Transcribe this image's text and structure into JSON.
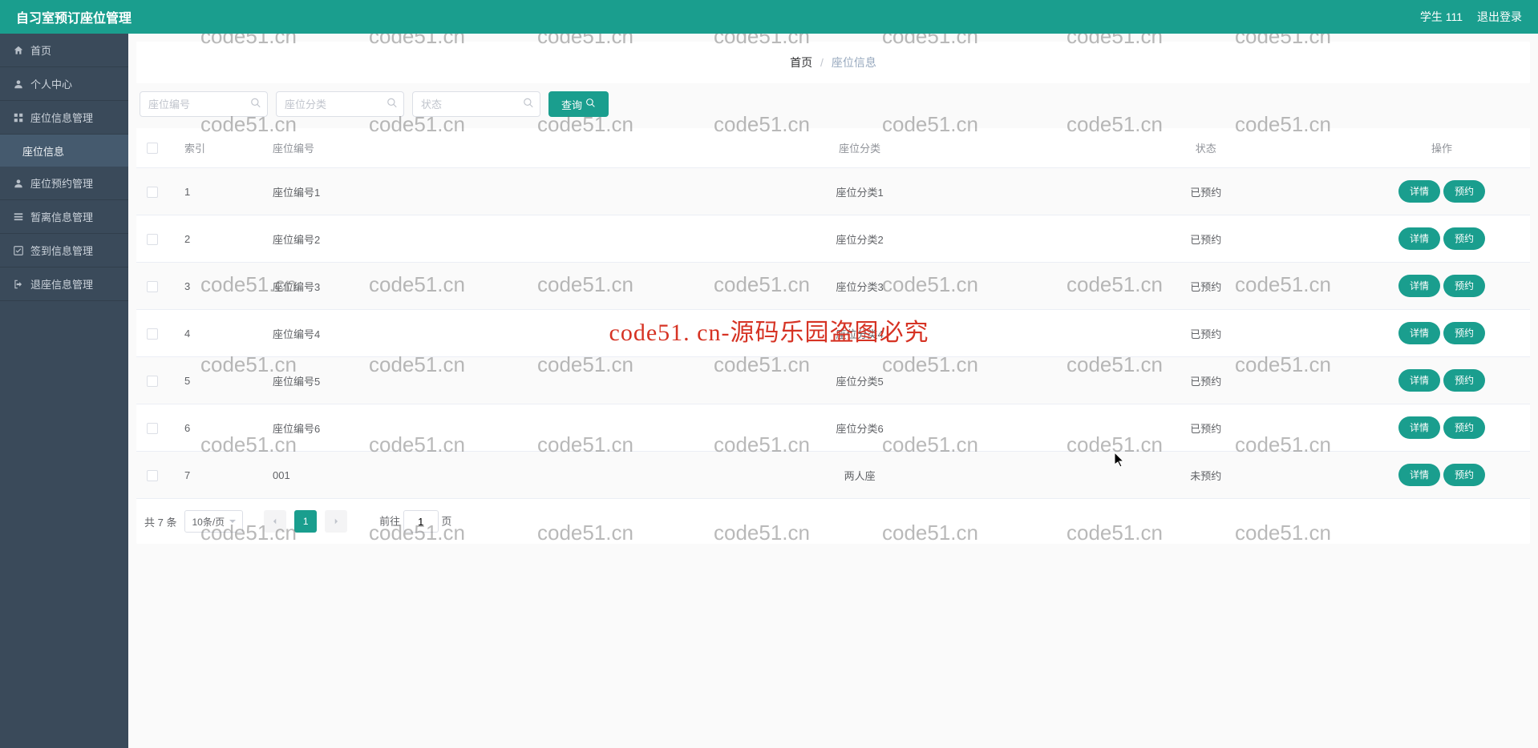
{
  "header": {
    "title": "自习室预订座位管理",
    "user": "学生 111",
    "logout": "退出登录"
  },
  "sidebar": {
    "items": [
      {
        "label": "首页",
        "icon": "home"
      },
      {
        "label": "个人中心",
        "icon": "user"
      },
      {
        "label": "座位信息管理",
        "icon": "grid",
        "children": [
          {
            "label": "座位信息"
          }
        ]
      },
      {
        "label": "座位预约管理",
        "icon": "user"
      },
      {
        "label": "暂离信息管理",
        "icon": "list"
      },
      {
        "label": "签到信息管理",
        "icon": "check"
      },
      {
        "label": "退座信息管理",
        "icon": "exit"
      }
    ]
  },
  "breadcrumb": {
    "home": "首页",
    "current": "座位信息"
  },
  "filters": {
    "seat_no_ph": "座位编号",
    "seat_cat_ph": "座位分类",
    "status_ph": "状态",
    "query_label": "查询"
  },
  "table": {
    "headers": {
      "index": "索引",
      "seat_no": "座位编号",
      "seat_cat": "座位分类",
      "status": "状态",
      "action": "操作"
    },
    "action_detail": "详情",
    "action_reserve": "预约",
    "rows": [
      {
        "index": "1",
        "seat_no": "座位编号1",
        "seat_cat": "座位分类1",
        "status": "已预约"
      },
      {
        "index": "2",
        "seat_no": "座位编号2",
        "seat_cat": "座位分类2",
        "status": "已预约"
      },
      {
        "index": "3",
        "seat_no": "座位编号3",
        "seat_cat": "座位分类3",
        "status": "已预约"
      },
      {
        "index": "4",
        "seat_no": "座位编号4",
        "seat_cat": "座位分类4",
        "status": "已预约"
      },
      {
        "index": "5",
        "seat_no": "座位编号5",
        "seat_cat": "座位分类5",
        "status": "已预约"
      },
      {
        "index": "6",
        "seat_no": "座位编号6",
        "seat_cat": "座位分类6",
        "status": "已预约"
      },
      {
        "index": "7",
        "seat_no": "001",
        "seat_cat": "两人座",
        "status": "未预约"
      }
    ]
  },
  "pagination": {
    "total_text": "共 7 条",
    "page_size": "10条/页",
    "current": "1",
    "goto_prefix": "前往",
    "goto_value": "1",
    "goto_suffix": "页"
  },
  "watermark": {
    "text": "code51.cn",
    "center": "code51. cn-源码乐园盗图必究"
  }
}
